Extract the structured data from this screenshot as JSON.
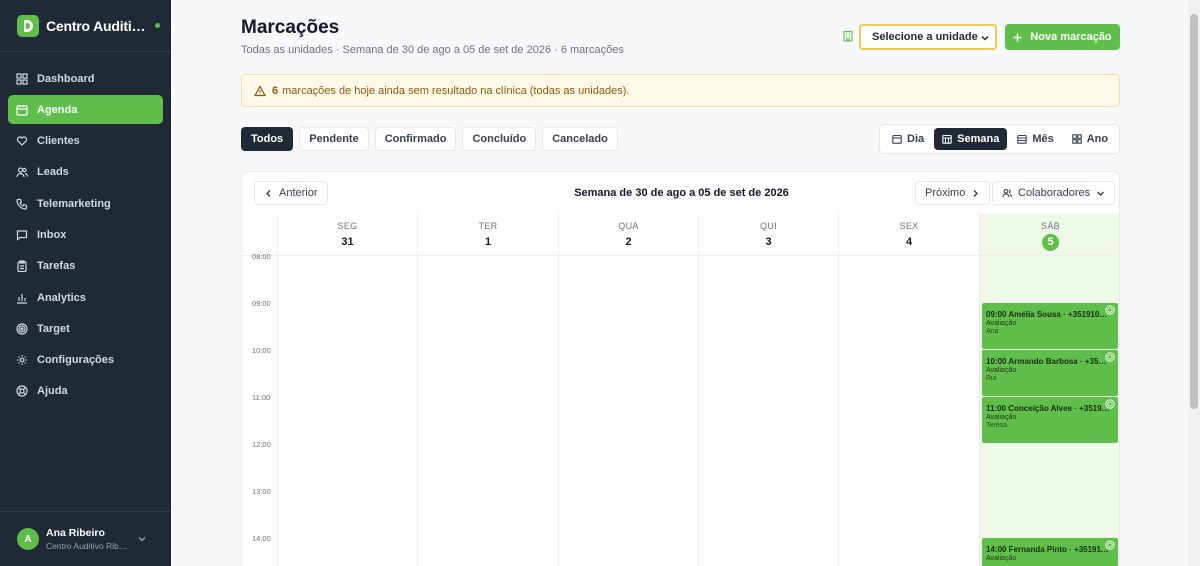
{
  "sidebar": {
    "brand": "Centro Auditi…",
    "items": [
      {
        "label": "Dashboard",
        "icon": "dashboard-icon"
      },
      {
        "label": "Agenda",
        "icon": "calendar-icon",
        "active": true
      },
      {
        "label": "Clientes",
        "icon": "heart-hand-icon"
      },
      {
        "label": "Leads",
        "icon": "users-icon"
      },
      {
        "label": "Telemarketing",
        "icon": "phone-icon"
      },
      {
        "label": "Inbox",
        "icon": "chat-icon"
      },
      {
        "label": "Tarefas",
        "icon": "clipboard-icon"
      },
      {
        "label": "Analytics",
        "icon": "bar-chart-icon"
      },
      {
        "label": "Target",
        "icon": "target-icon"
      },
      {
        "label": "Configurações",
        "icon": "gear-icon"
      },
      {
        "label": "Ajuda",
        "icon": "help-icon"
      }
    ],
    "user": {
      "initial": "A",
      "name": "Ana Ribeiro",
      "org": "Centro Auditivo Rib…"
    }
  },
  "header": {
    "title": "Marcações",
    "subtitle": "Todas as unidades · Semana de 30 de ago a 05 de set de 2026 · 6 marcações",
    "unit_select": "Selecione a unidade",
    "new_button": "Nova marcação"
  },
  "alert": {
    "count": "6",
    "text": "marcações de hoje ainda sem resultado na clínica (todas as unidades)."
  },
  "filters": [
    "Todos",
    "Pendente",
    "Confirmado",
    "Concluído",
    "Cancelado"
  ],
  "views": [
    "Dia",
    "Semana",
    "Mês",
    "Ano"
  ],
  "calendar": {
    "prev": "Anterior",
    "week_title": "Semana de 30 de ago a 05 de set de 2026",
    "next": "Próximo",
    "collaborators": "Colaboradores",
    "days": [
      {
        "name": "SEG",
        "num": "31"
      },
      {
        "name": "TER",
        "num": "1"
      },
      {
        "name": "QUA",
        "num": "2"
      },
      {
        "name": "QUI",
        "num": "3"
      },
      {
        "name": "SEX",
        "num": "4"
      },
      {
        "name": "SÁB",
        "num": "5",
        "today": true
      }
    ],
    "hours": [
      "08:00",
      "09:00",
      "10:00",
      "11:00",
      "12:00",
      "13:00",
      "14:00"
    ],
    "events": [
      {
        "title": "09:00 Amélia Sousa · +3519100…",
        "type": "Avaliação",
        "person": "Ana"
      },
      {
        "title": "10:00 Armando Barbosa · +3519…",
        "type": "Avaliação",
        "person": "Rui"
      },
      {
        "title": "11:00 Conceição Alves · +35191…",
        "type": "Avaliação",
        "person": "Teresa"
      },
      {
        "title": "14:00 Fernanda Pinto · +3519110…",
        "type": "Avaliação",
        "person": ""
      }
    ]
  },
  "colors": {
    "accent": "#5fbf4a",
    "sidebar": "#1f2a36",
    "alert_bg": "#fef9e8",
    "select_border": "#f2c94c"
  }
}
